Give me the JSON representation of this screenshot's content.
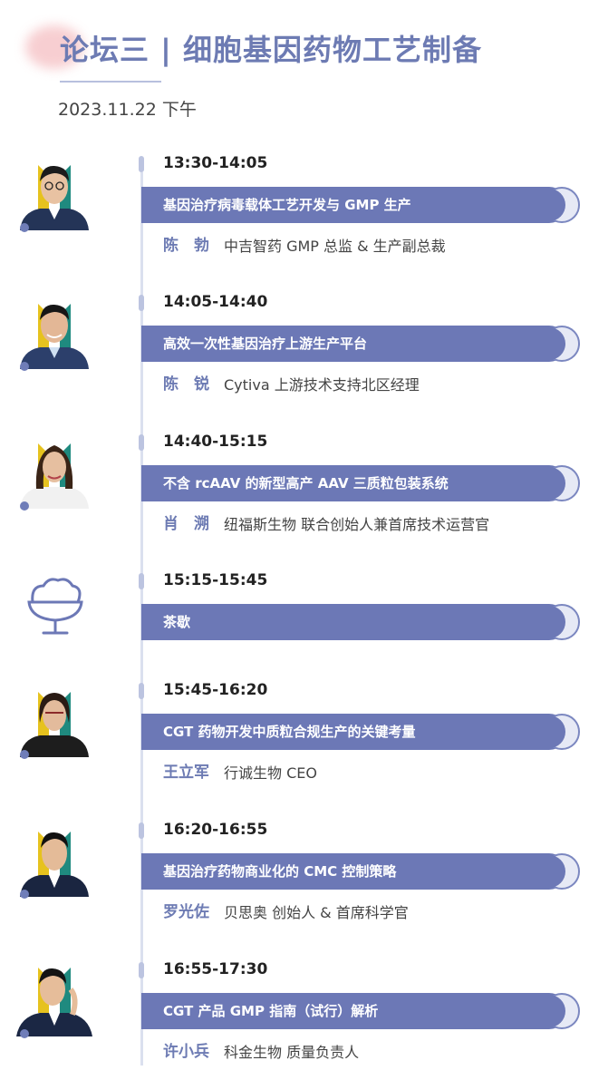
{
  "header": {
    "title": "论坛三 | 细胞基因药物工艺制备",
    "date": "2023.11.22 下午"
  },
  "colors": {
    "accent": "#6c78b6",
    "title": "#6d7bb3",
    "timeline": "#dbe0ef"
  },
  "sessions": [
    {
      "time": "13:30-14:05",
      "topic": "基因治疗病毒载体工艺开发与 GMP 生产",
      "speaker_name": "陈　勃",
      "speaker_role": "中吉智药  GMP 总监 & 生产副总裁"
    },
    {
      "time": "14:05-14:40",
      "topic": "高效一次性基因治疗上游生产平台",
      "speaker_name": "陈　锐",
      "speaker_role": "Cytiva  上游技术支持北区经理"
    },
    {
      "time": "14:40-15:15",
      "topic": "不含 rcAAV 的新型高产 AAV 三质粒包装系统",
      "speaker_name": "肖　溯",
      "speaker_role": "纽福斯生物  联合创始人兼首席技术运营官"
    },
    {
      "time": "15:15-15:45",
      "topic": "茶歇",
      "icon": "tea-break-icon"
    },
    {
      "time": "15:45-16:20",
      "topic": "CGT 药物开发中质粒合规生产的关键考量",
      "speaker_name": "王立军",
      "speaker_role": "行诚生物  CEO"
    },
    {
      "time": "16:20-16:55",
      "topic": "基因治疗药物商业化的 CMC 控制策略",
      "speaker_name": "罗光佐",
      "speaker_role": "贝思奥  创始人 & 首席科学官"
    },
    {
      "time": "16:55-17:30",
      "topic": "CGT 产品 GMP 指南（试行）解析",
      "speaker_name": "许小兵",
      "speaker_role": "科金生物  质量负责人"
    }
  ]
}
